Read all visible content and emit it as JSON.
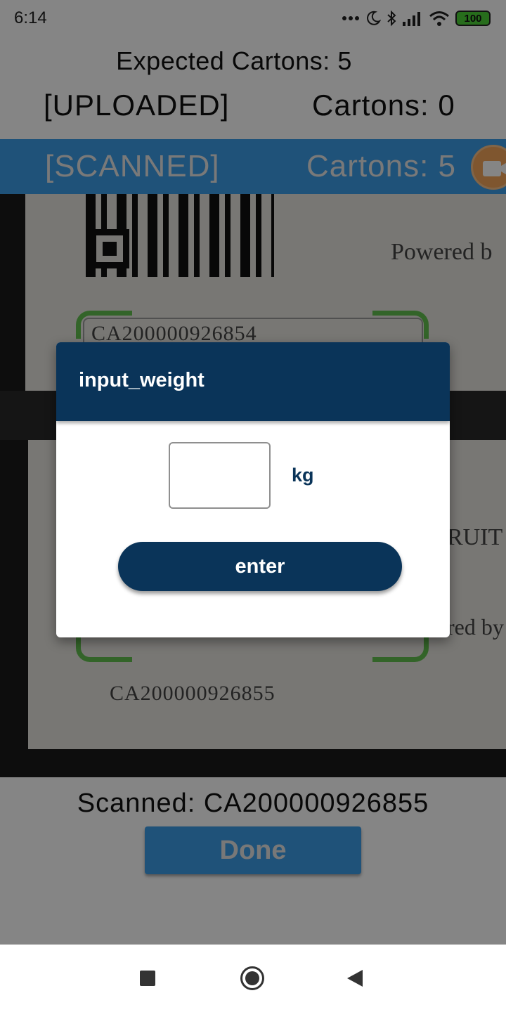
{
  "status_bar": {
    "time": "6:14",
    "battery": "100",
    "icons": [
      "more-dots-icon",
      "moon-icon",
      "bluetooth-icon",
      "signal-icon",
      "wifi-icon",
      "battery-icon"
    ]
  },
  "summary": {
    "expected": "Expected Cartons: 5",
    "uploaded_label": "[UPLOADED]",
    "uploaded_count": "Cartons: 0"
  },
  "scanned_bar": {
    "label": "[SCANNED]",
    "count": "Cartons: 5",
    "icon": "video-camera-icon"
  },
  "camera_view": {
    "powered_top": "Powered b",
    "code_top": "CA200000926854",
    "fruit_text": "RUIT",
    "powered_bottom": "red by",
    "code_bottom": "CA200000926855"
  },
  "bottom": {
    "scanned_result": "Scanned: CA200000926855",
    "done_label": "Done"
  },
  "dialog": {
    "title": "input_weight",
    "weight_value": "",
    "unit": "kg",
    "enter_label": "enter"
  },
  "nav_bar": {
    "icons": [
      "recents-icon",
      "home-icon",
      "back-icon"
    ]
  },
  "colors": {
    "dialog_primary": "#0a3459",
    "scanned_bar": "#3d9ee9",
    "scan_corners": "#62c04f",
    "camera_button": "#f3a55a",
    "battery": "#4cd137"
  }
}
